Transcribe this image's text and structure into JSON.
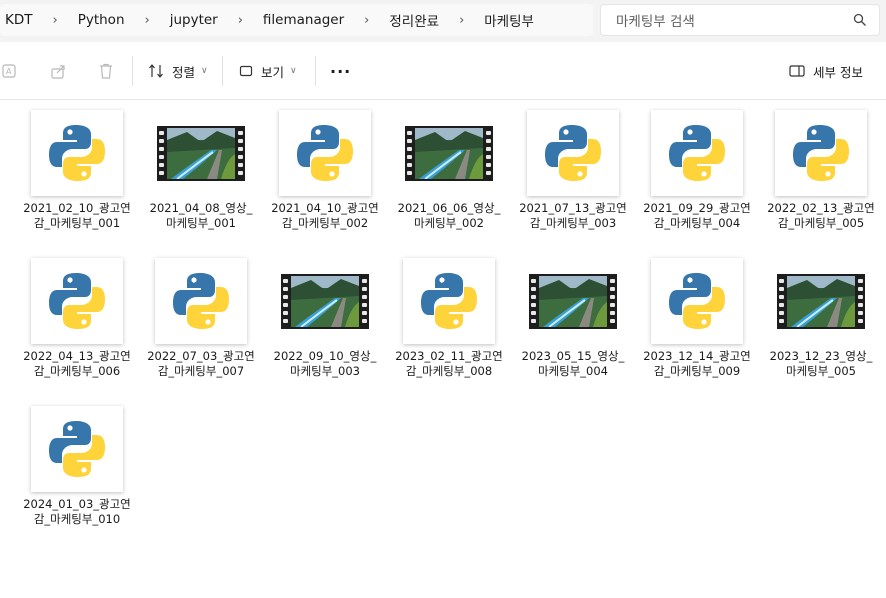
{
  "breadcrumb": [
    "KDT",
    "Python",
    "jupyter",
    "filemanager",
    "정리완료",
    "마케팅부"
  ],
  "search": {
    "placeholder": "마케팅부 검색"
  },
  "toolbar": {
    "sort_label": "정렬",
    "view_label": "보기",
    "details_label": "세부 정보"
  },
  "files": [
    {
      "type": "python",
      "label": "2021_02_10_광고연감_마케팅부_001"
    },
    {
      "type": "video",
      "label": "2021_04_08_영상_마케팅부_001"
    },
    {
      "type": "python",
      "label": "2021_04_10_광고연감_마케팅부_002"
    },
    {
      "type": "video",
      "label": "2021_06_06_영상_마케팅부_002"
    },
    {
      "type": "python",
      "label": "2021_07_13_광고연감_마케팅부_003"
    },
    {
      "type": "python",
      "label": "2021_09_29_광고연감_마케팅부_004"
    },
    {
      "type": "python",
      "label": "2022_02_13_광고연감_마케팅부_005"
    },
    {
      "type": "python",
      "label": "2022_04_13_광고연감_마케팅부_006"
    },
    {
      "type": "python",
      "label": "2022_07_03_광고연감_마케팅부_007"
    },
    {
      "type": "video",
      "label": "2022_09_10_영상_마케팅부_003"
    },
    {
      "type": "python",
      "label": "2023_02_11_광고연감_마케팅부_008"
    },
    {
      "type": "video",
      "label": "2023_05_15_영상_마케팅부_004"
    },
    {
      "type": "python",
      "label": "2023_12_14_광고연감_마케팅부_009"
    },
    {
      "type": "video",
      "label": "2023_12_23_영상_마케팅부_005"
    },
    {
      "type": "python",
      "label": "2024_01_03_광고연감_마케팅부_010"
    }
  ],
  "colors": {
    "python_blue": "#3776ab",
    "python_yellow": "#ffd43b",
    "accent": "#005fb8"
  }
}
